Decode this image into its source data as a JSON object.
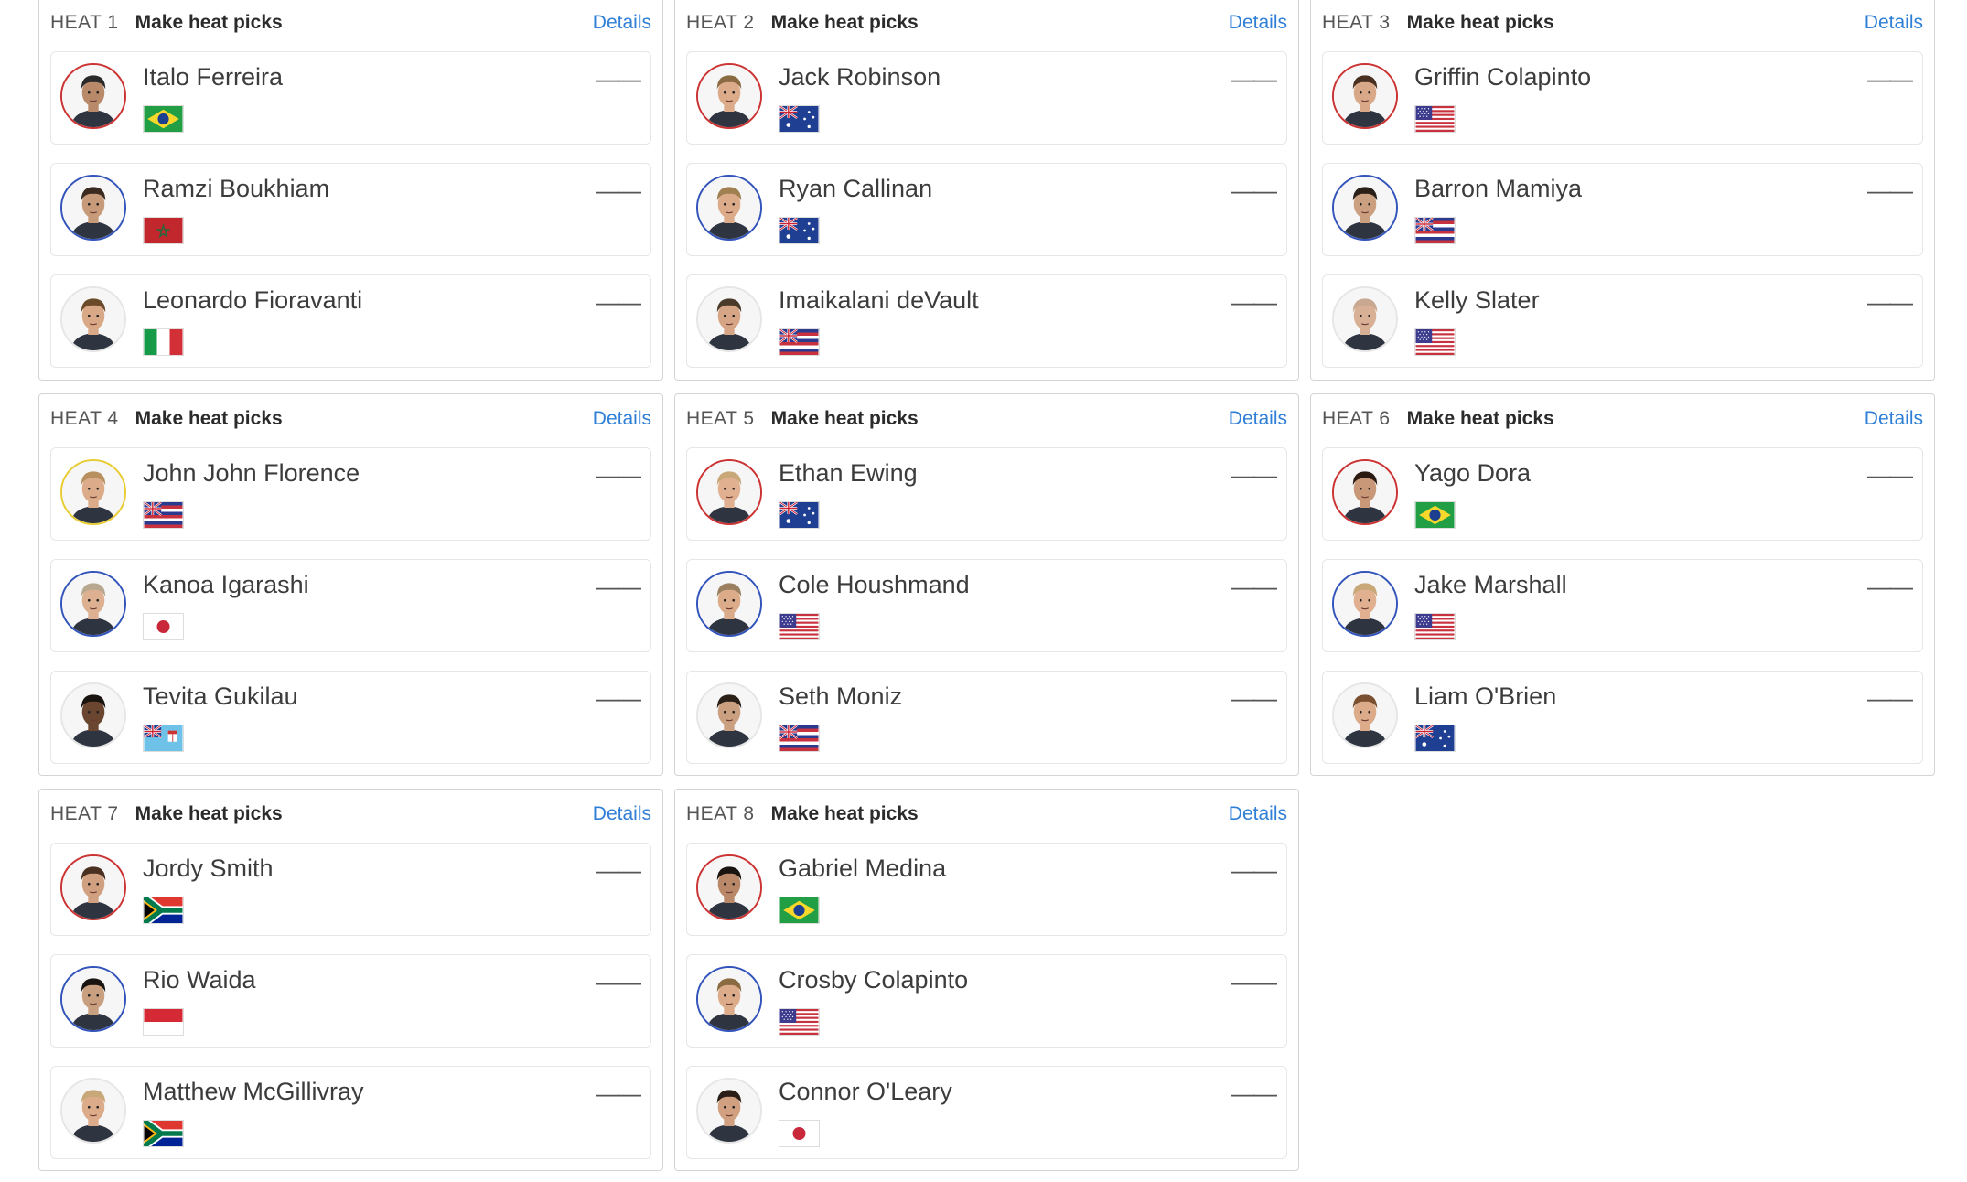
{
  "heats": [
    {
      "label": "HEAT 1",
      "title": "Make heat picks",
      "details": "Details",
      "surfers": [
        {
          "name": "Italo Ferreira",
          "score": "——",
          "flag": "brazil-flag",
          "ring": "#cc3333",
          "hair": "#2a2a2a",
          "skin": "#b98a6a"
        },
        {
          "name": "Ramzi Boukhiam",
          "score": "——",
          "flag": "morocco-flag",
          "ring": "#3355bb",
          "hair": "#3a2a20",
          "skin": "#c79b7a"
        },
        {
          "name": "Leonardo Fioravanti",
          "score": "——",
          "flag": "italy-flag",
          "ring": "#e6e6e6",
          "hair": "#6b4a2a",
          "skin": "#d9a886"
        }
      ]
    },
    {
      "label": "HEAT 2",
      "title": "Make heat picks",
      "details": "Details",
      "surfers": [
        {
          "name": "Jack Robinson",
          "score": "——",
          "flag": "australia-flag",
          "ring": "#cc3333",
          "hair": "#8a6a40",
          "skin": "#dcab8a"
        },
        {
          "name": "Ryan Callinan",
          "score": "——",
          "flag": "australia-flag",
          "ring": "#3355bb",
          "hair": "#a08050",
          "skin": "#dcab8a"
        },
        {
          "name": "Imaikalani deVault",
          "score": "——",
          "flag": "hawaii-flag",
          "ring": "#e6e6e6",
          "hair": "#4a3a2a",
          "skin": "#d5a585"
        }
      ]
    },
    {
      "label": "HEAT 3",
      "title": "Make heat picks",
      "details": "Details",
      "surfers": [
        {
          "name": "Griffin Colapinto",
          "score": "——",
          "flag": "usa-flag",
          "ring": "#cc3333",
          "hair": "#4a3020",
          "skin": "#d8a888"
        },
        {
          "name": "Barron Mamiya",
          "score": "——",
          "flag": "hawaii-flag",
          "ring": "#3355bb",
          "hair": "#2a2018",
          "skin": "#caa080"
        },
        {
          "name": "Kelly Slater",
          "score": "——",
          "flag": "usa-flag",
          "ring": "#e6e6e6",
          "hair": "#c8a890",
          "skin": "#d8b095"
        }
      ]
    },
    {
      "label": "HEAT 4",
      "title": "Make heat picks",
      "details": "Details",
      "surfers": [
        {
          "name": "John John Florence",
          "score": "——",
          "flag": "hawaii-flag",
          "ring": "#e8cc33",
          "hair": "#b89060",
          "skin": "#dcab8a"
        },
        {
          "name": "Kanoa Igarashi",
          "score": "——",
          "flag": "japan-flag",
          "ring": "#3355bb",
          "hair": "#b8a890",
          "skin": "#dcb090"
        },
        {
          "name": "Tevita Gukilau",
          "score": "——",
          "flag": "fiji-flag",
          "ring": "#e6e6e6",
          "hair": "#1a1410",
          "skin": "#6a4530"
        }
      ]
    },
    {
      "label": "HEAT 5",
      "title": "Make heat picks",
      "details": "Details",
      "surfers": [
        {
          "name": "Ethan Ewing",
          "score": "——",
          "flag": "australia-flag",
          "ring": "#cc3333",
          "hair": "#c8a878",
          "skin": "#e0b090"
        },
        {
          "name": "Cole Houshmand",
          "score": "——",
          "flag": "usa-flag",
          "ring": "#3355bb",
          "hair": "#9a8060",
          "skin": "#dcab8a"
        },
        {
          "name": "Seth Moniz",
          "score": "——",
          "flag": "hawaii-flag",
          "ring": "#e6e6e6",
          "hair": "#2a2018",
          "skin": "#caa080"
        }
      ]
    },
    {
      "label": "HEAT 6",
      "title": "Make heat picks",
      "details": "Details",
      "surfers": [
        {
          "name": "Yago Dora",
          "score": "——",
          "flag": "brazil-flag",
          "ring": "#cc3333",
          "hair": "#2a1a12",
          "skin": "#c89878"
        },
        {
          "name": "Jake Marshall",
          "score": "——",
          "flag": "usa-flag",
          "ring": "#3355bb",
          "hair": "#c8a878",
          "skin": "#e0b090"
        },
        {
          "name": "Liam O'Brien",
          "score": "——",
          "flag": "australia-flag",
          "ring": "#e6e6e6",
          "hair": "#7a5030",
          "skin": "#dcab8a"
        }
      ]
    },
    {
      "label": "HEAT 7",
      "title": "Make heat picks",
      "details": "Details",
      "surfers": [
        {
          "name": "Jordy Smith",
          "score": "——",
          "flag": "south-africa-flag",
          "ring": "#cc3333",
          "hair": "#4a3020",
          "skin": "#d0a080"
        },
        {
          "name": "Rio Waida",
          "score": "——",
          "flag": "indonesia-flag",
          "ring": "#3355bb",
          "hair": "#1a1410",
          "skin": "#c8a080"
        },
        {
          "name": "Matthew McGillivray",
          "score": "——",
          "flag": "south-africa-flag",
          "ring": "#e6e6e6",
          "hair": "#c8a878",
          "skin": "#dcab8a"
        }
      ]
    },
    {
      "label": "HEAT 8",
      "title": "Make heat picks",
      "details": "Details",
      "surfers": [
        {
          "name": "Gabriel Medina",
          "score": "——",
          "flag": "brazil-flag",
          "ring": "#cc3333",
          "hair": "#1a1410",
          "skin": "#b88868"
        },
        {
          "name": "Crosby Colapinto",
          "score": "——",
          "flag": "usa-flag",
          "ring": "#3355bb",
          "hair": "#8a6a40",
          "skin": "#dcab8a"
        },
        {
          "name": "Connor O'Leary",
          "score": "——",
          "flag": "japan-flag",
          "ring": "#e6e6e6",
          "hair": "#2a1e16",
          "skin": "#d0a080"
        }
      ]
    }
  ]
}
